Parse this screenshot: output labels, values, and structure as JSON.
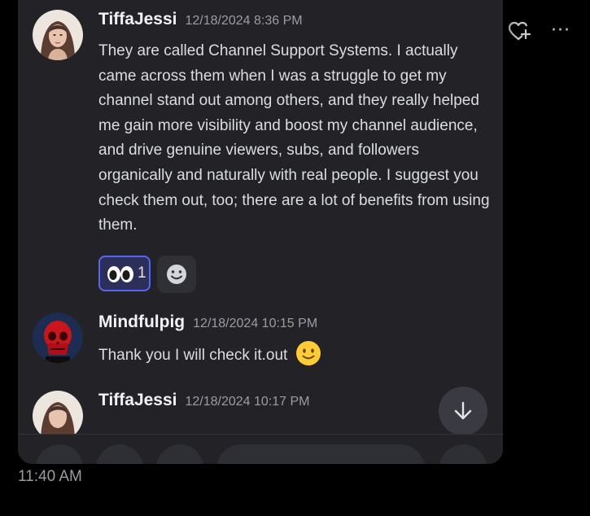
{
  "post_actions": {
    "like_icon": "heart-plus-icon",
    "more_icon": "more-horizontal-icon",
    "more_label": "···"
  },
  "messages": [
    {
      "author": "TiffaJessi",
      "timestamp": "12/18/2024 8:36 PM",
      "text": "They are called Channel Support Systems. I actually came across them when I was a struggle to get my channel stand out among others, and they really helped me gain more visibility and boost my channel audience, and drive genuine viewers, subs, and followers organically and naturally with real people. I suggest you check them out, too; there are a lot of benefits from using them.",
      "reactions": [
        {
          "emoji": "eyes-emoji",
          "count": "1"
        }
      ],
      "add_reaction_icon": "smiley-icon"
    },
    {
      "author": "Mindfulpig",
      "timestamp": "12/18/2024 10:15 PM",
      "text": "Thank you I will check it.out",
      "trailing_emoji": "slightly-smiling-face-emoji"
    },
    {
      "author": "TiffaJessi",
      "timestamp": "12/18/2024 10:17 PM"
    }
  ],
  "scroll_button_icon": "arrow-down-icon",
  "post_time": "11:40 AM",
  "colors": {
    "background": "#000000",
    "panel": "#222227",
    "author": "#f2f3f5",
    "timestamp": "#9c9ca6",
    "body": "#dbdee1",
    "reaction_accent": "#5865f2"
  }
}
